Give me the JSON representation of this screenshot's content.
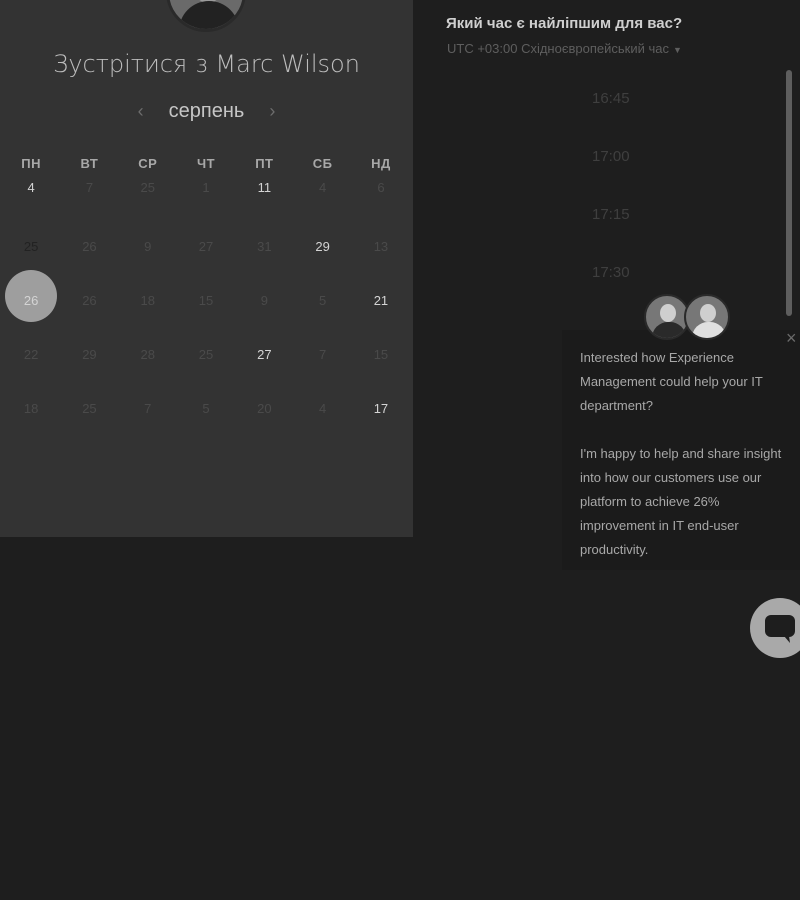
{
  "host": {
    "title": "Зустрітися з Marc Wilson"
  },
  "calendar": {
    "month": "серпень",
    "weekdays": [
      "ПН",
      "ВТ",
      "СР",
      "ЧТ",
      "ПТ",
      "СБ",
      "НД"
    ],
    "rows": [
      [
        {
          "d": "4",
          "a": true
        },
        {
          "d": "7",
          "a": false
        },
        {
          "d": "25",
          "a": false
        },
        {
          "d": "1",
          "a": false
        },
        {
          "d": "11",
          "a": true
        },
        {
          "d": "4",
          "a": false
        },
        {
          "d": "6",
          "a": false
        }
      ],
      [
        {
          "d": "25",
          "a": true,
          "sel": true
        },
        {
          "d": "26",
          "a": false
        },
        {
          "d": "9",
          "a": false
        },
        {
          "d": "27",
          "a": false
        },
        {
          "d": "31",
          "a": false
        },
        {
          "d": "29",
          "a": true
        },
        {
          "d": "13",
          "a": false
        }
      ],
      [
        {
          "d": "26",
          "a": true
        },
        {
          "d": "26",
          "a": false
        },
        {
          "d": "18",
          "a": false
        },
        {
          "d": "15",
          "a": false
        },
        {
          "d": "9",
          "a": false
        },
        {
          "d": "5",
          "a": false
        },
        {
          "d": "21",
          "a": true
        }
      ],
      [
        {
          "d": "22",
          "a": false
        },
        {
          "d": "29",
          "a": false
        },
        {
          "d": "28",
          "a": false
        },
        {
          "d": "25",
          "a": false
        },
        {
          "d": "27",
          "a": true
        },
        {
          "d": "7",
          "a": false
        },
        {
          "d": "15",
          "a": false
        }
      ],
      [
        {
          "d": "18",
          "a": false
        },
        {
          "d": "25",
          "a": false
        },
        {
          "d": "7",
          "a": false
        },
        {
          "d": "5",
          "a": false
        },
        {
          "d": "20",
          "a": false
        },
        {
          "d": "4",
          "a": false
        },
        {
          "d": "17",
          "a": true
        }
      ]
    ]
  },
  "schedule": {
    "question": "Який час є найліпшим для вас?",
    "timezone": "UTC +03:00 Східноєвропейський час",
    "slots": [
      "16:45",
      "17:00",
      "17:15",
      "17:30"
    ]
  },
  "chat": {
    "message1": "Interested how Experience Management could help your IT department?",
    "message2": "I'm happy to help and share insight into how our customers use our platform to achieve 26% improvement in IT end-user productivity."
  }
}
